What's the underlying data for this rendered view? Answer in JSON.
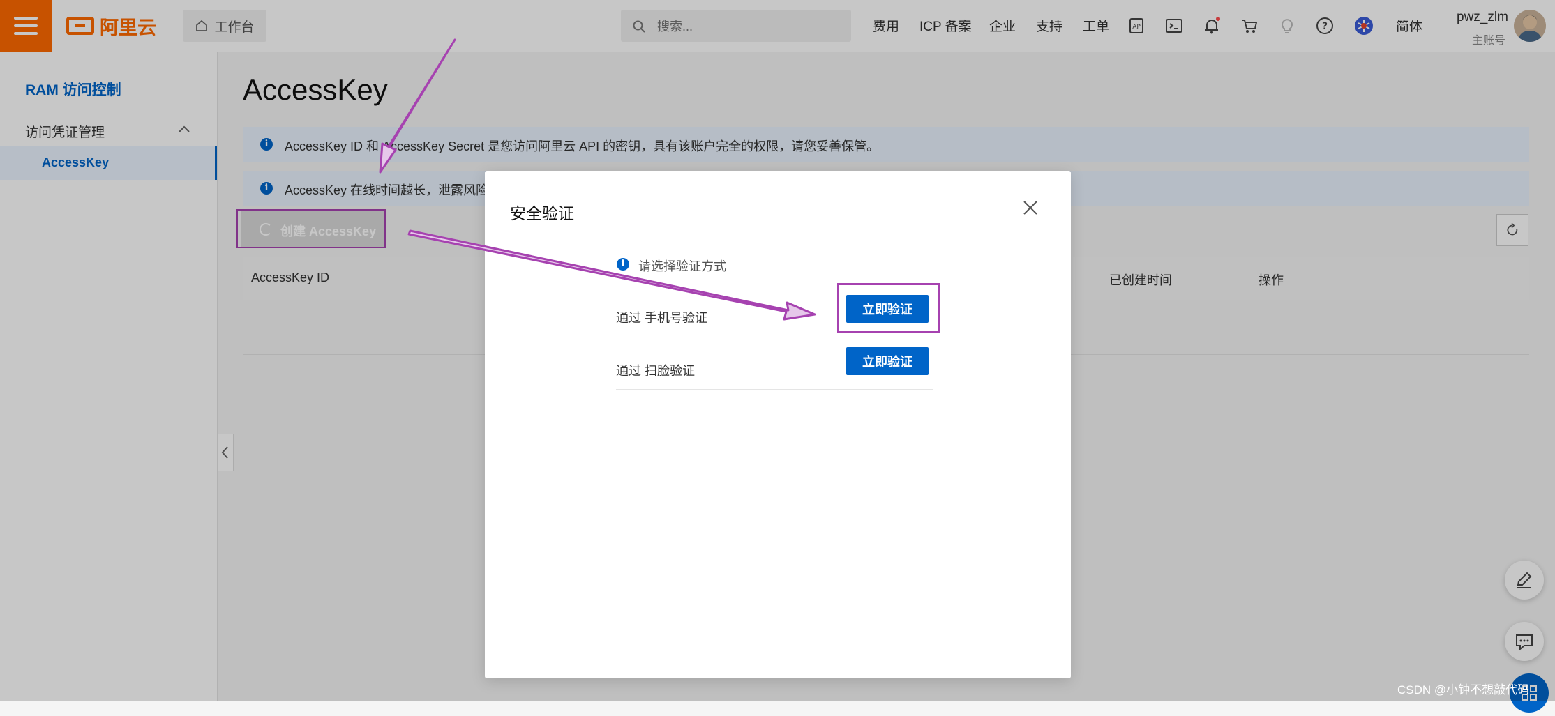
{
  "header": {
    "logo_text": "阿里云",
    "workbench_label": "工作台",
    "search_placeholder": "搜索...",
    "nav": [
      "费用",
      "ICP 备案",
      "企业",
      "支持",
      "工单"
    ],
    "lang": "简体",
    "user_name": "pwz_zlm",
    "user_role": "主账号"
  },
  "sidebar": {
    "title": "RAM 访问控制",
    "group": "访问凭证管理",
    "items": [
      {
        "label": "AccessKey"
      }
    ]
  },
  "main": {
    "title": "AccessKey",
    "notices": [
      "AccessKey ID 和 AccessKey Secret 是您访问阿里云 API 的密钥，具有该账户完全的权限，请您妥善保管。",
      "AccessKey 在线时间越长，泄露风险越"
    ],
    "create_button": "创建 AccessKey",
    "table_headers": [
      "AccessKey ID",
      "已创建时间",
      "操作"
    ]
  },
  "modal": {
    "title": "安全验证",
    "hint": "请选择验证方式",
    "options": [
      {
        "label": "通过 手机号验证",
        "button": "立即验证"
      },
      {
        "label": "通过 扫脸验证",
        "button": "立即验证"
      }
    ]
  },
  "watermark": "CSDN @小钟不想敲代码",
  "colors": {
    "brand": "#ff6a00",
    "primary": "#0064c8",
    "annotation": "#a642b0"
  }
}
